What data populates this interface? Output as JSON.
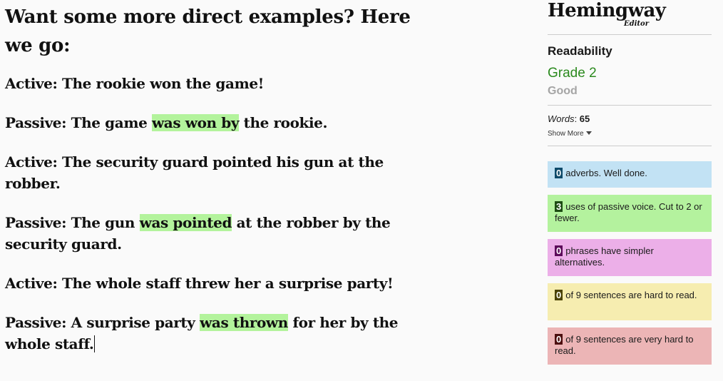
{
  "editor": {
    "heading": "Want some more direct examples? Here we go:",
    "paragraphs": [
      {
        "before": "Active: The rookie won the game!",
        "highlight": "",
        "after": ""
      },
      {
        "before": "Passive: The game ",
        "highlight": "was won by",
        "after": " the rookie."
      },
      {
        "before": "Active: The security guard pointed his gun at the robber.",
        "highlight": "",
        "after": ""
      },
      {
        "before": "Passive: The gun ",
        "highlight": "was pointed",
        "after": " at the robber by the security guard."
      },
      {
        "before": "Active: The whole staff threw her a surprise party!",
        "highlight": "",
        "after": ""
      },
      {
        "before": "Passive: A surprise party ",
        "highlight": "was thrown",
        "after": " for her by the whole staff."
      }
    ]
  },
  "sidebar": {
    "logo": {
      "title": "Hemingway",
      "subtitle": "Editor"
    },
    "readability": {
      "label": "Readability",
      "grade": "Grade 2",
      "rating": "Good"
    },
    "words": {
      "label": "Words",
      "separator": ": ",
      "count": "65"
    },
    "show_more": "Show More",
    "cards": [
      {
        "count": "0",
        "text": "adverbs. Well done.",
        "color": "#c2e2f4"
      },
      {
        "count": "3",
        "text": "uses of passive voice. Cut to 2 or fewer.",
        "color": "#b4f29e"
      },
      {
        "count": "0",
        "text": "phrases have simpler alternatives.",
        "color": "#ecafe8"
      },
      {
        "count": "0",
        "text": "of 9 sentences are hard to read.",
        "color": "#f6edb0"
      },
      {
        "count": "0",
        "text": "of 9 sentences are very hard to read.",
        "color": "#ecb5b6"
      }
    ]
  },
  "colors": {
    "passive_highlight": "#b3f39c",
    "grade_green": "#2b8a1e",
    "good_gray": "#a5a5a5"
  }
}
